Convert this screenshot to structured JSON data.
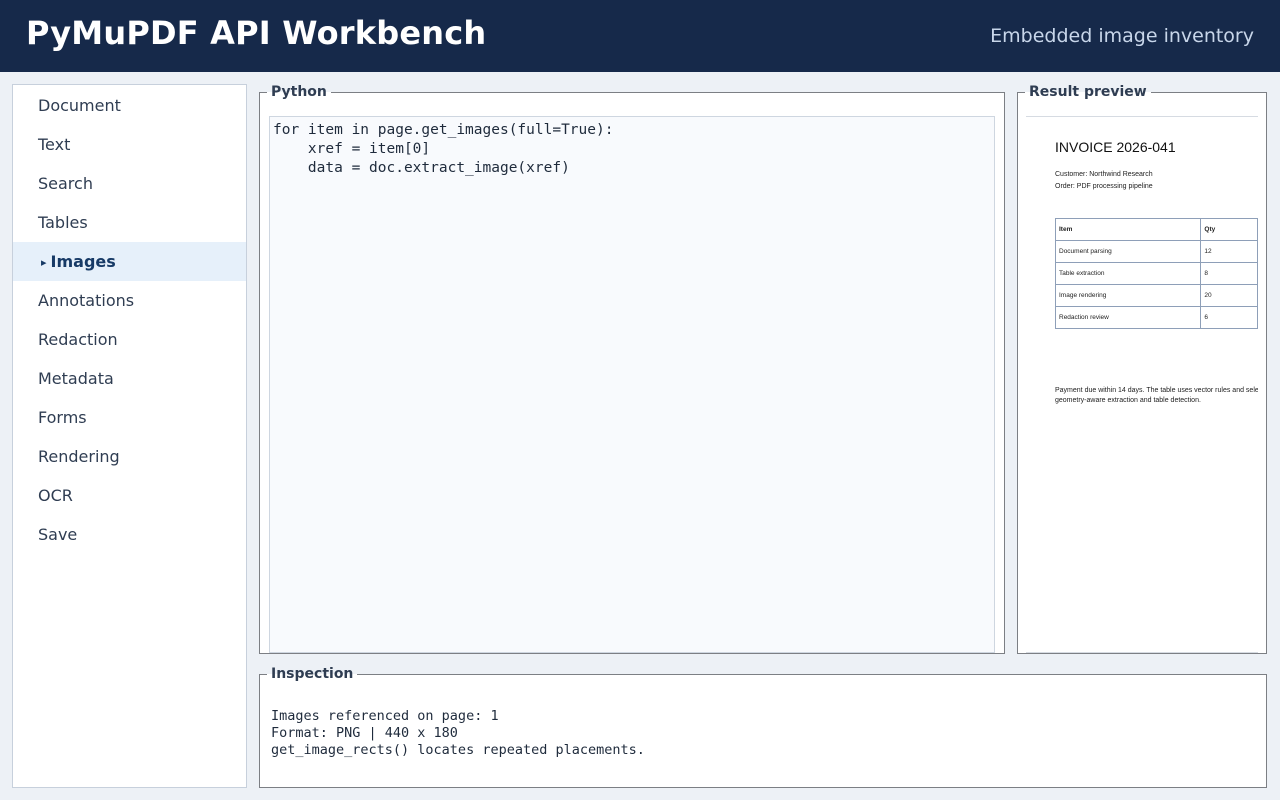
{
  "header": {
    "title": "PyMuPDF API Workbench",
    "subtitle": "Embedded image inventory"
  },
  "sidebar": {
    "items": [
      {
        "label": "Document"
      },
      {
        "label": "Text"
      },
      {
        "label": "Search"
      },
      {
        "label": "Tables"
      },
      {
        "label": "Images",
        "active": true
      },
      {
        "label": "Annotations"
      },
      {
        "label": "Redaction"
      },
      {
        "label": "Metadata"
      },
      {
        "label": "Forms"
      },
      {
        "label": "Rendering"
      },
      {
        "label": "OCR"
      },
      {
        "label": "Save"
      }
    ],
    "active_marker": "▸"
  },
  "python": {
    "legend": "Python",
    "code": [
      "for item in page.get_images(full=True):",
      "    xref = item[0]",
      "    data = doc.extract_image(xref)"
    ]
  },
  "result": {
    "legend": "Result preview",
    "doc": {
      "title": "INVOICE 2026-041",
      "customer": "Customer: Northwind Research",
      "order": "Order: PDF processing pipeline",
      "table_headers": [
        "Item",
        "Qty"
      ],
      "table_rows": [
        [
          "Document parsing",
          "12"
        ],
        [
          "Table extraction",
          "8"
        ],
        [
          "Image rendering",
          "20"
        ],
        [
          "Redaction review",
          "6"
        ]
      ],
      "footer_line1": "Payment due within 14 days. The table uses vector rules and sele",
      "footer_line2": "geometry-aware extraction and table detection."
    }
  },
  "inspection": {
    "legend": "Inspection",
    "lines": [
      "Images referenced on page: 1",
      "Format: PNG | 440 x 180",
      "get_image_rects() locates repeated placements."
    ]
  }
}
